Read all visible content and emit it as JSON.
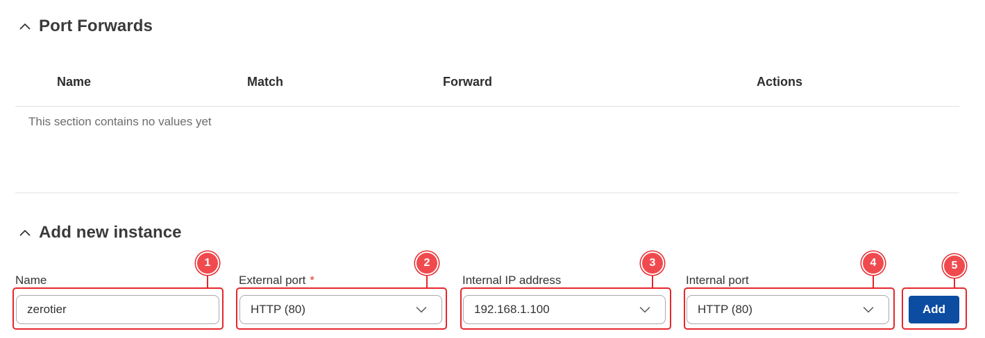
{
  "port_forwards": {
    "title": "Port Forwards",
    "columns": [
      "Name",
      "Match",
      "Forward",
      "Actions"
    ],
    "empty_message": "This section contains no values yet"
  },
  "add_instance": {
    "title": "Add new instance",
    "fields": [
      {
        "label": "Name",
        "value": "zerotier",
        "required": false,
        "type": "text"
      },
      {
        "label": "External port",
        "value": "HTTP (80)",
        "required": true,
        "type": "select"
      },
      {
        "label": "Internal IP address",
        "value": "192.168.1.100",
        "required": false,
        "type": "select"
      },
      {
        "label": "Internal port",
        "value": "HTTP (80)",
        "required": false,
        "type": "select"
      }
    ],
    "add_label": "Add",
    "required_mark": "*"
  },
  "callouts": [
    "1",
    "2",
    "3",
    "4",
    "5"
  ],
  "icons": {
    "section_toggle": "chevron-up-icon",
    "dropdown": "chevron-down-icon"
  },
  "colors": {
    "accent": "#0c4da2",
    "callout": "#e5262b",
    "required": "#e0342c"
  }
}
